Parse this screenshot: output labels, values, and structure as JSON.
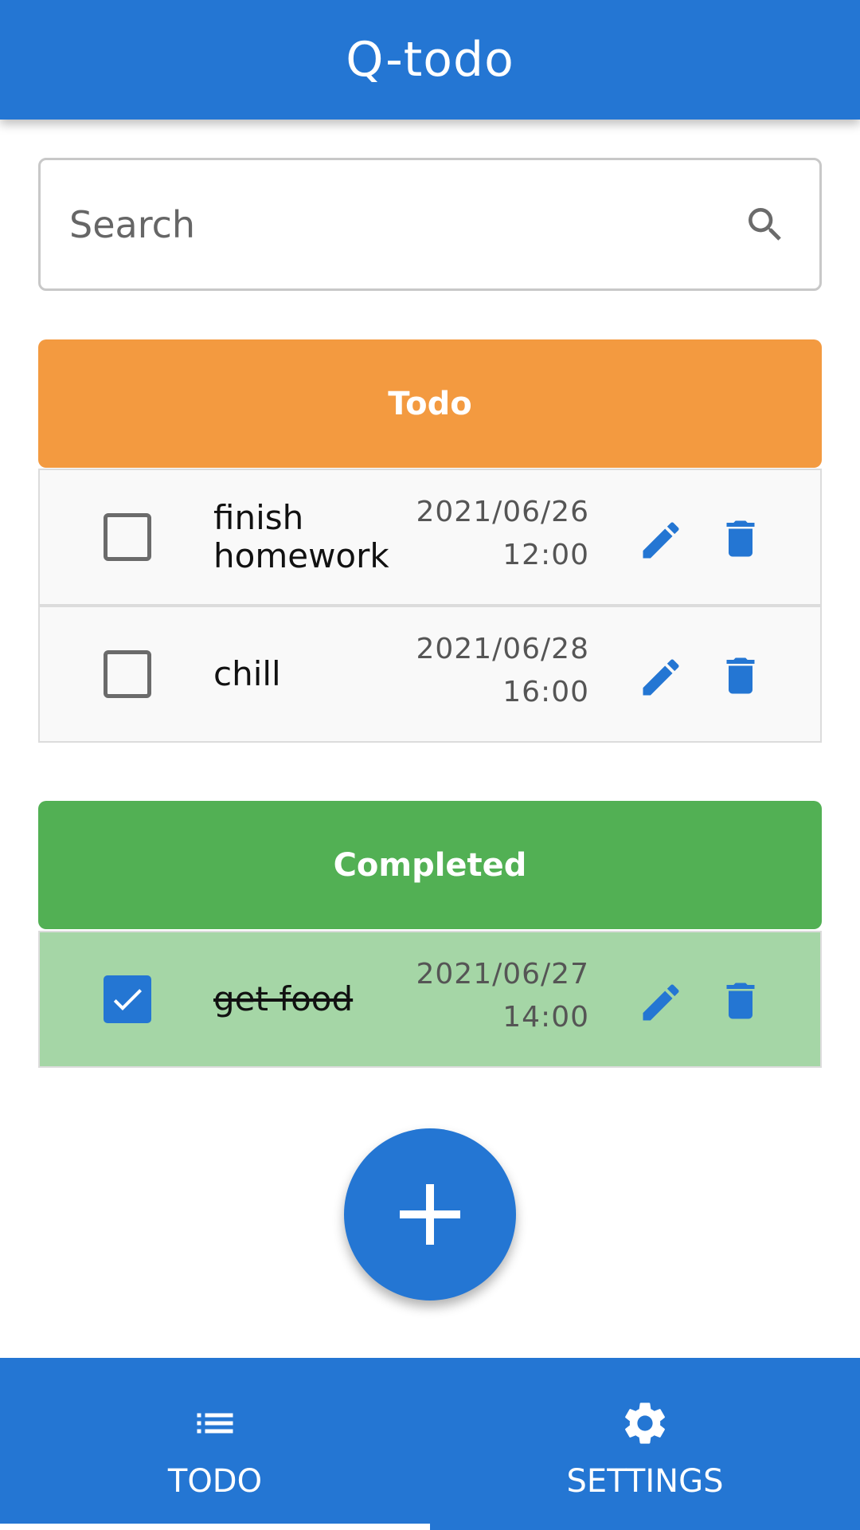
{
  "app": {
    "title": "Q-todo"
  },
  "search": {
    "placeholder": "Search"
  },
  "sections": {
    "todo": {
      "title": "Todo",
      "tasks": [
        {
          "title": "finish homework",
          "date": "2021/06/26",
          "time": "12:00",
          "done": false
        },
        {
          "title": "chill",
          "date": "2021/06/28",
          "time": "16:00",
          "done": false
        }
      ]
    },
    "completed": {
      "title": "Completed",
      "tasks": [
        {
          "title": "get food",
          "date": "2021/06/27",
          "time": "14:00",
          "done": true
        }
      ]
    }
  },
  "nav": {
    "tabs": [
      {
        "label": "TODO",
        "icon": "list-icon",
        "active": true
      },
      {
        "label": "SETTINGS",
        "icon": "gear-icon",
        "active": false
      }
    ]
  },
  "colors": {
    "primary": "#2476d3",
    "todo_header": "#f39a40",
    "completed_header": "#52b054",
    "completed_row": "#a5d6a6"
  },
  "icons": {
    "fab": "plus-icon",
    "edit": "pencil-icon",
    "delete": "trash-icon",
    "search": "search-icon"
  }
}
